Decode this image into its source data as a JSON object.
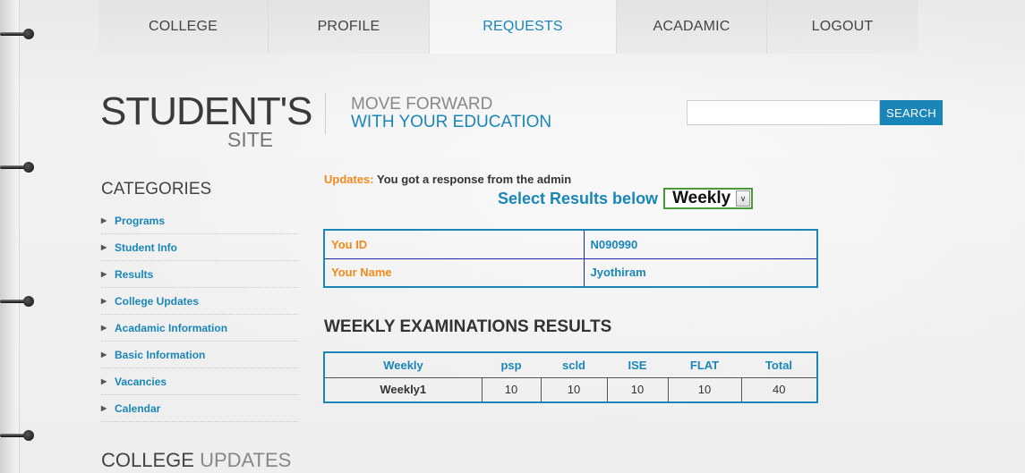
{
  "nav": {
    "items": [
      "COLLEGE",
      "PROFILE",
      "REQUESTS",
      "ACADAMIC",
      "LOGOUT"
    ]
  },
  "logo": {
    "main": "STUDENT'S",
    "sub": "SITE",
    "tagline_1": "MOVE FORWARD",
    "tagline_2": "WITH YOUR EDUCATION"
  },
  "search": {
    "value": "",
    "button": "SEARCH"
  },
  "sidebar": {
    "title": "CATEGORIES",
    "items": [
      "Programs",
      "Student Info",
      "Results",
      "College Updates",
      "Acadamic Information",
      "Basic Information",
      "Vacancies",
      "Calendar"
    ],
    "updates_title_dark": "COLLEGE",
    "updates_title_light": "UPDATES"
  },
  "main": {
    "updates_label": "Updates:",
    "updates_message": "You got a response from the admin",
    "select_label": "Select Results below",
    "select_value": "Weekly",
    "info": [
      {
        "key": "You ID",
        "value": "N090990"
      },
      {
        "key": "Your Name",
        "value": "Jyothiram"
      }
    ],
    "results_title": "WEEKLY EXAMINATIONS RESULTS",
    "results_headers": [
      "Weekly",
      "psp",
      "scld",
      "ISE",
      "FLAT",
      "Total"
    ],
    "results_rows": [
      [
        "Weekly1",
        "10",
        "10",
        "10",
        "10",
        "40"
      ]
    ]
  },
  "colors": {
    "accent": "#1a86b8",
    "orange": "#f08a1d"
  }
}
